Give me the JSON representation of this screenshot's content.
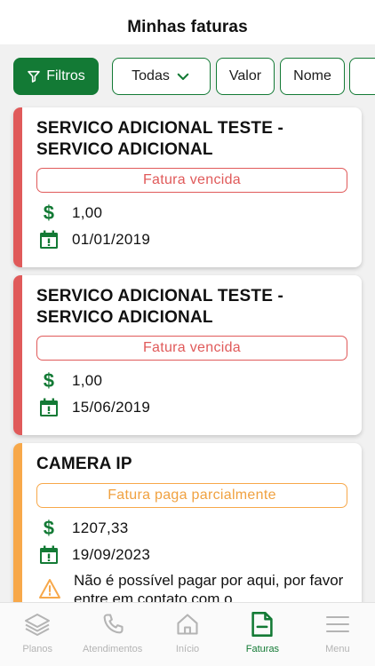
{
  "header": {
    "title": "Minhas faturas"
  },
  "filters": {
    "filter_button": "Filtros",
    "status_select": "Todas",
    "sort_value": "Valor",
    "sort_name": "Nome"
  },
  "invoices": [
    {
      "title": "SERVICO ADICIONAL TESTE - SERVICO ADICIONAL",
      "status": "Fatura vencida",
      "amount": "1,00",
      "due_date": "01/01/2019"
    },
    {
      "title": "SERVICO ADICIONAL TESTE - SERVICO ADICIONAL",
      "status": "Fatura vencida",
      "amount": "1,00",
      "due_date": "15/06/2019"
    },
    {
      "title": "CAMERA IP",
      "status": "Fatura paga parcialmente",
      "amount": "1207,33",
      "due_date": "19/09/2023",
      "warning": "Não é possível pagar por aqui, por favor entre em contato com o"
    }
  ],
  "colors": {
    "brand": "#137a35",
    "overdue": "#e05a5a",
    "partial": "#f7a84a"
  },
  "tabbar": {
    "items": [
      {
        "label": "Planos",
        "icon": "layers-icon"
      },
      {
        "label": "Atendimentos",
        "icon": "phone-icon"
      },
      {
        "label": "Início",
        "icon": "home-icon"
      },
      {
        "label": "Faturas",
        "icon": "invoice-icon",
        "active": true
      },
      {
        "label": "Menu",
        "icon": "menu-icon"
      }
    ]
  }
}
